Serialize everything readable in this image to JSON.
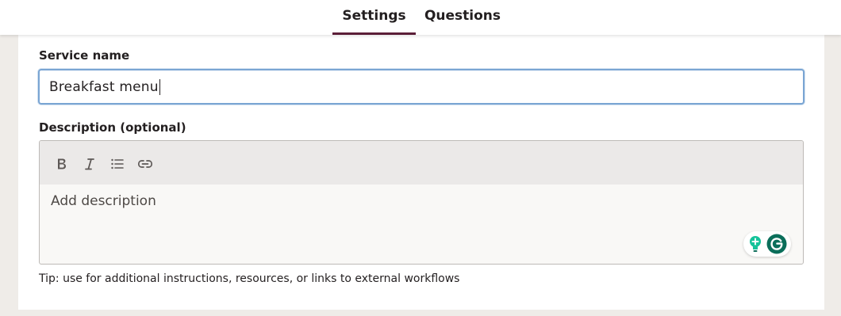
{
  "tabs": [
    {
      "label": "Settings",
      "active": true
    },
    {
      "label": "Questions",
      "active": false
    }
  ],
  "form": {
    "service_name_label": "Service name",
    "service_name_value": "Breakfast menu",
    "description_label": "Description (optional)",
    "description_placeholder": "Add description",
    "tip": "Tip: use for additional instructions, resources, or links to external workflows"
  },
  "toolbar_icons": [
    "bold-icon",
    "italic-icon",
    "bulleted-list-icon",
    "link-icon"
  ],
  "colors": {
    "active_tab_underline": "#5b1e38",
    "focus_border": "#7aa5d3",
    "grammarly_green": "#15c39a",
    "grammarly_dark": "#0b6e5a"
  }
}
